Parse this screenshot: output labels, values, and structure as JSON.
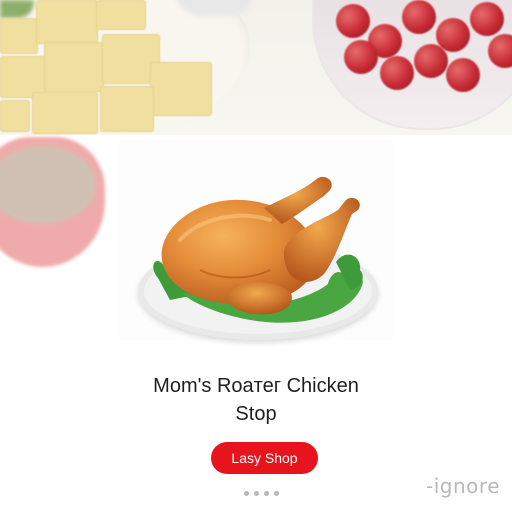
{
  "hero": {
    "image_desc_icon": "food-spread-image"
  },
  "product": {
    "image_icon": "roast-chicken-image",
    "title_line1": "Mom's Roaтег Chicken",
    "title_line2": "Stop"
  },
  "cta": {
    "label": "Lasy Shop",
    "color": "#e8141c"
  },
  "pager": {
    "count": 4
  },
  "corner_text": "-ignore"
}
